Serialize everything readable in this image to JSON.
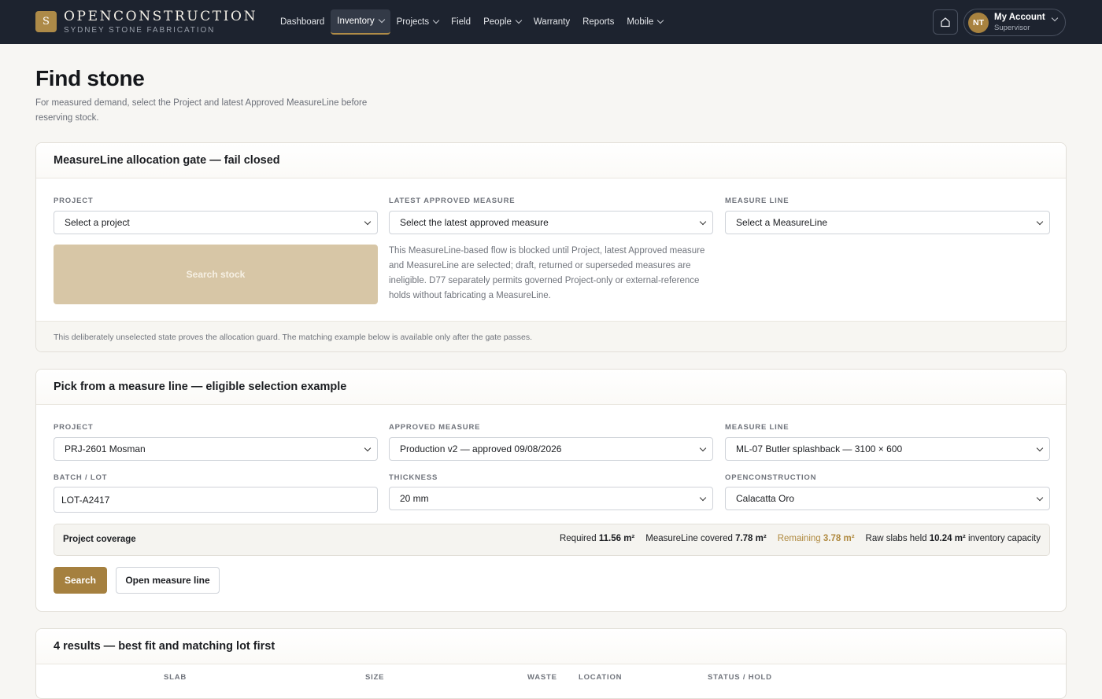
{
  "brand": {
    "logo_letter": "S",
    "name": "OPENCONSTRUCTION",
    "subtitle": "SYDNEY STONE FABRICATION"
  },
  "nav": {
    "items": [
      {
        "label": "Dashboard",
        "active": false,
        "has_dropdown": false
      },
      {
        "label": "Inventory",
        "active": true,
        "has_dropdown": true
      },
      {
        "label": "Projects",
        "active": false,
        "has_dropdown": true
      },
      {
        "label": "Field",
        "active": false,
        "has_dropdown": false
      },
      {
        "label": "People",
        "active": false,
        "has_dropdown": true
      },
      {
        "label": "Warranty",
        "active": false,
        "has_dropdown": false
      },
      {
        "label": "Reports",
        "active": false,
        "has_dropdown": false
      },
      {
        "label": "Mobile",
        "active": false,
        "has_dropdown": true
      }
    ]
  },
  "account": {
    "initials": "NT",
    "name": "My Account",
    "role": "Supervisor"
  },
  "page": {
    "title": "Find stone",
    "subtitle": "For measured demand, select the Project and latest Approved MeasureLine before reserving stock."
  },
  "gate_card": {
    "title": "MeasureLine allocation gate — fail closed",
    "project_label": "PROJECT",
    "project_value": "Select a project",
    "measure_label": "LATEST APPROVED MEASURE",
    "measure_value": "Select the latest approved measure",
    "line_label": "MEASURE LINE",
    "line_value": "Select a MeasureLine",
    "search_button": "Search stock",
    "note": "This MeasureLine-based flow is blocked until Project, latest Approved measure and MeasureLine are selected; draft, returned or superseded measures are ineligible. D77 separately permits governed Project-only or external-reference holds without fabricating a MeasureLine.",
    "footer": "This deliberately unselected state proves the allocation guard. The matching example below is available only after the gate passes."
  },
  "pick_card": {
    "title": "Pick from a measure line — eligible selection example",
    "project_label": "PROJECT",
    "project_value": "PRJ-2601 Mosman",
    "measure_label": "APPROVED MEASURE",
    "measure_value": "Production v2 — approved 09/08/2026",
    "line_label": "MEASURE LINE",
    "line_value": "ML-07 Butler splashback — 3100 × 600",
    "batch_label": "BATCH / LOT",
    "batch_value": "LOT-A2417",
    "thickness_label": "THICKNESS",
    "thickness_value": "20 mm",
    "material_label": "OPENCONSTRUCTION",
    "material_value": "Calacatta Oro",
    "coverage": {
      "label": "Project coverage",
      "required_label": "Required",
      "required_value": "11.56 m²",
      "covered_label": "MeasureLine covered",
      "covered_value": "7.78 m²",
      "remaining_label": "Remaining",
      "remaining_value": "3.78 m²",
      "held_label": "Raw slabs held",
      "held_value": "10.24 m²",
      "held_suffix": "inventory capacity"
    },
    "search_button": "Search",
    "open_button": "Open measure line"
  },
  "results_card": {
    "title": "4 results — best fit and matching lot first",
    "columns": [
      "SLAB",
      "SIZE",
      "WASTE",
      "LOCATION",
      "STATUS / HOLD"
    ]
  },
  "colors": {
    "accent": "#a5803f",
    "nav_bg": "#1d232f",
    "warning": "#b08a40",
    "page_bg": "#f7f6f3"
  },
  "icons": {
    "home": "home-icon",
    "chevron": "chevron-down-icon"
  }
}
